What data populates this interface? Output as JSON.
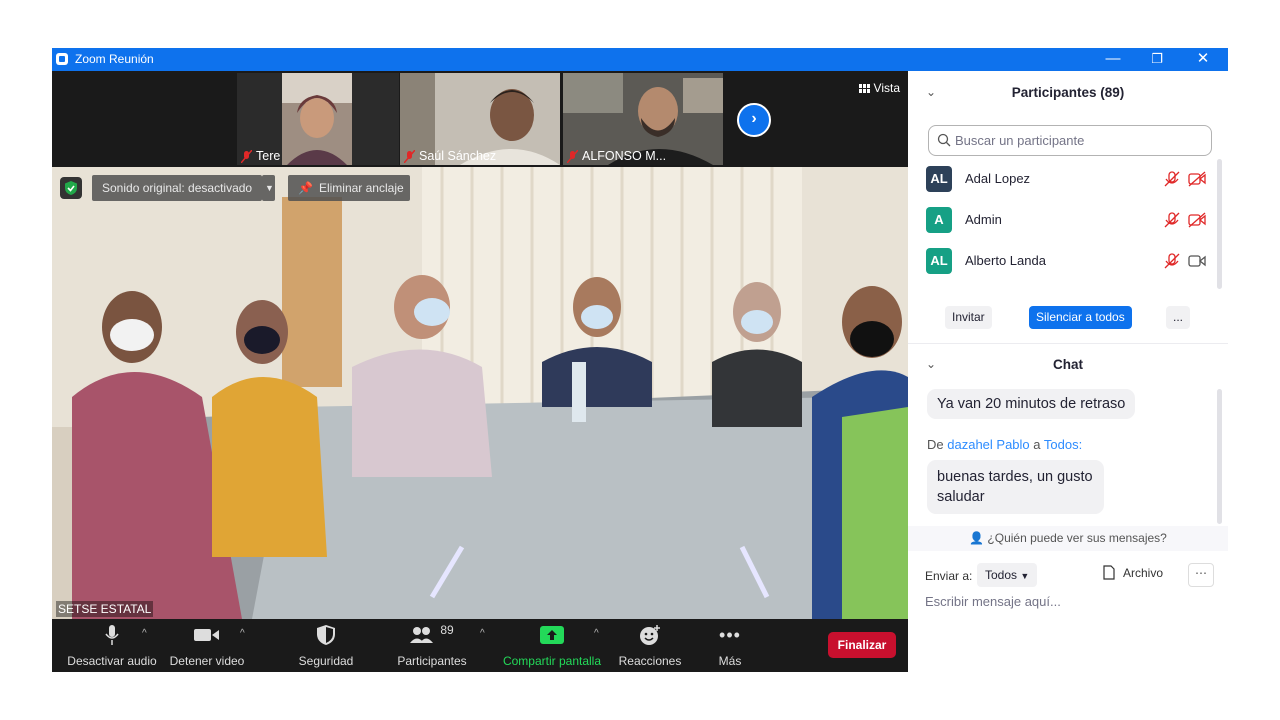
{
  "window": {
    "title": "Zoom Reunión",
    "controls": [
      "—",
      "❐",
      "✕"
    ]
  },
  "video_strip": {
    "thumbnails": [
      {
        "name": "Tere"
      },
      {
        "name": "Saúl Sánchez"
      },
      {
        "name": "ALFONSO M..."
      }
    ],
    "view_label": "Vista"
  },
  "main_video": {
    "original_sound": "Sonido original: desactivado",
    "unpin": "Eliminar anclaje",
    "name_tag": "SETSE ESTATAL"
  },
  "toolbar": {
    "mute": "Desactivar audio",
    "stop_video": "Detener video",
    "security": "Seguridad",
    "participants": "Participantes",
    "participants_count": "89",
    "share_screen": "Compartir pantalla",
    "reactions": "Reacciones",
    "more": "Más",
    "end": "Finalizar"
  },
  "participants_panel": {
    "title": "Participantes (89)",
    "search_placeholder": "Buscar un participante",
    "list": [
      {
        "initials": "AL",
        "name": "Adal Lopez",
        "color": "#2d4159",
        "video_off": true
      },
      {
        "initials": "A",
        "name": "Admin",
        "color": "#16a085",
        "video_off": true
      },
      {
        "initials": "AL",
        "name": "Alberto Landa",
        "color": "#16a085",
        "video_off": false
      }
    ],
    "invite": "Invitar",
    "mute_all": "Silenciar a todos",
    "more": "..."
  },
  "chat": {
    "title": "Chat",
    "messages": [
      {
        "text": "Ya van 20 minutos de retraso"
      }
    ],
    "from_prefix": "De",
    "from_name": "dazahel Pablo",
    "from_mid": "a",
    "from_to": "Todos:",
    "message2_line1": "buenas tardes, un gusto",
    "message2_line2": "saludar",
    "who_can_see": "¿Quién puede ver sus mensajes?",
    "send_to_label": "Enviar a:",
    "send_to_value": "Todos",
    "file_label": "Archivo",
    "input_placeholder": "Escribir mensaje aquí..."
  }
}
